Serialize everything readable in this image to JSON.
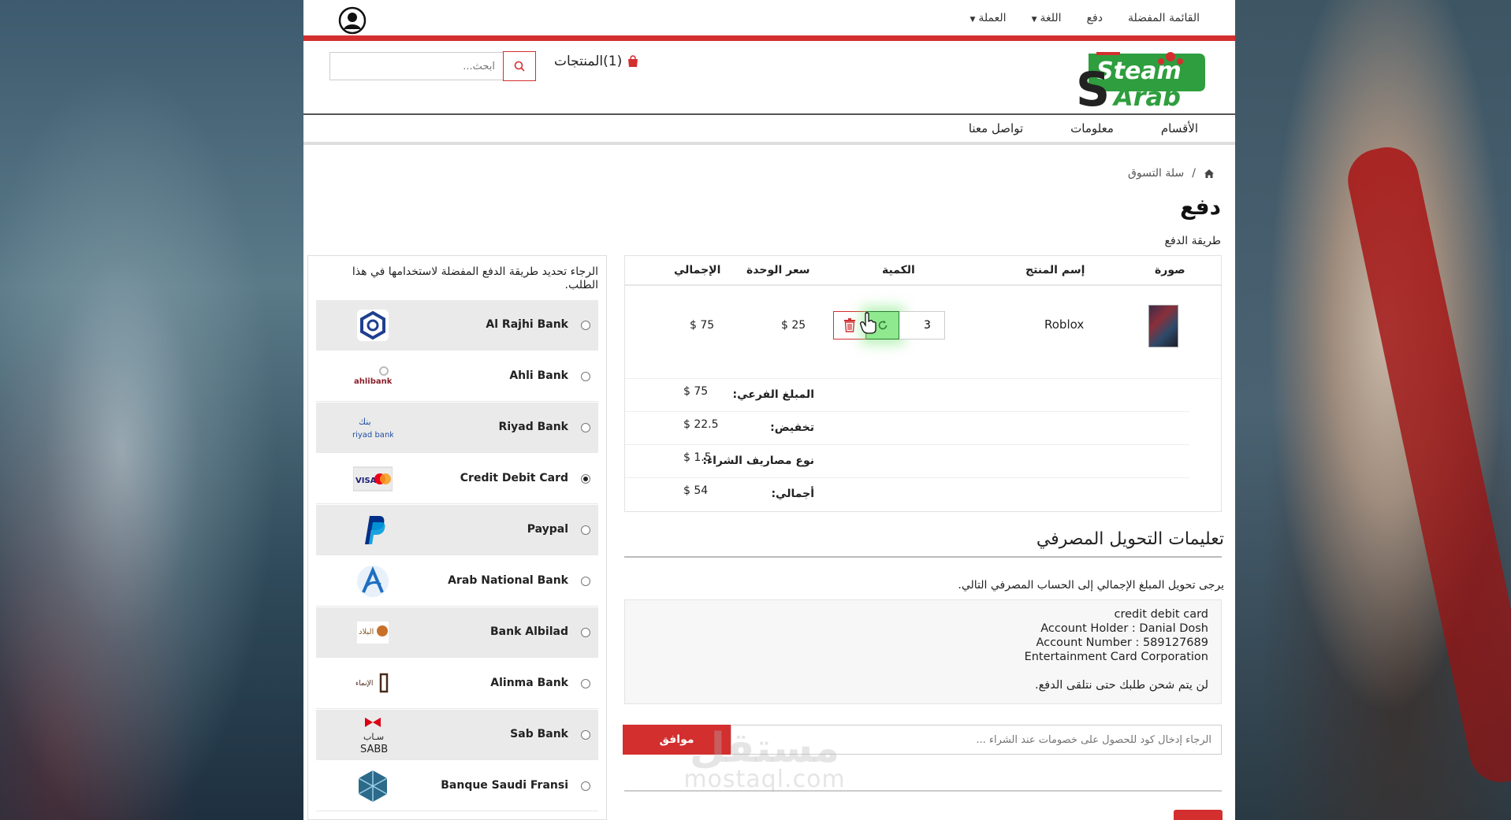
{
  "topbar": {
    "links": [
      "القائمة المفضلة",
      "دفع",
      "اللغة",
      "العملة"
    ]
  },
  "header": {
    "logo_text_top": "Steam",
    "logo_text_bottom": "Arab",
    "cart_label": "(1)المنتجات",
    "search_placeholder": "ابحث..."
  },
  "nav": {
    "items": [
      "الأقسام",
      "معلومات",
      "تواصل معنا"
    ]
  },
  "breadcrumb": {
    "separator": "/",
    "current": "سلة التسوق"
  },
  "page": {
    "title": "دفع",
    "payment_method_label": "طريقة الدفع"
  },
  "cart": {
    "headers": {
      "image": "صورة",
      "name": "إسم المنتج",
      "quantity": "الكمية",
      "unit_price": "سعر الوحدة",
      "total": "الإجمالي"
    },
    "items": [
      {
        "name": "Roblox",
        "quantity": "3",
        "unit_price": "$ 25",
        "total": "$ 75"
      }
    ],
    "summary": [
      {
        "label": "المبلغ الفرعي:",
        "value": "$ 75"
      },
      {
        "label": "تخفيض:",
        "value": "$ 22.5"
      },
      {
        "label": "نوع مصاريف الشراء:",
        "value": "$ 1.5"
      },
      {
        "label": "أجمالي:",
        "value": "$ 54"
      }
    ]
  },
  "methods": {
    "intro": "الرجاء تحديد طريقة الدفع المفضلة لاستخدامها في هذا الطلب.",
    "selected": "Credit Debit Card",
    "items": [
      {
        "name": "Al Rajhi Bank",
        "icon": "alrajhi-logo",
        "logo_text": ""
      },
      {
        "name": "Ahli Bank",
        "icon": "ahlibank-logo",
        "logo_text": "ahlibank"
      },
      {
        "name": "Riyad Bank",
        "icon": "riyadbank-logo",
        "logo_text": "riyad bank"
      },
      {
        "name": "Credit Debit Card",
        "icon": "visa-mastercard-logo",
        "logo_text": "VISA"
      },
      {
        "name": "Paypal",
        "icon": "paypal-logo",
        "logo_text": ""
      },
      {
        "name": "Arab National Bank",
        "icon": "anb-logo",
        "logo_text": ""
      },
      {
        "name": "Bank Albilad",
        "icon": "albilad-logo",
        "logo_text": ""
      },
      {
        "name": "Alinma Bank",
        "icon": "alinma-logo",
        "logo_text": ""
      },
      {
        "name": "Sab Bank",
        "icon": "sabb-logo",
        "logo_text": "SABB"
      },
      {
        "name": "Banque Saudi Fransi",
        "icon": "bsf-logo",
        "logo_text": ""
      }
    ]
  },
  "transfer": {
    "title": "تعليمات التحويل المصرفي",
    "note": "يرجى تحويل المبلغ الإجمالي إلى الحساب المصرفي التالي.",
    "account_lines": [
      "credit debit card",
      "Account Holder : Danial Dosh",
      "Account Number : 589127689",
      "Entertainment Card Corporation"
    ],
    "no_ship": "لن يتم شحن طلبك حتى نتلقى الدفع."
  },
  "coupon": {
    "placeholder": "الرجاء إدخال كود للحصول على خصومات عند الشراء ...",
    "button": "موافق"
  },
  "watermark": {
    "ar": "مستقل",
    "en": "mostaql.com"
  },
  "colors": {
    "accent": "#d32f2f",
    "update_button": "#8fe98f",
    "logo_green": "#2e9e3e"
  }
}
